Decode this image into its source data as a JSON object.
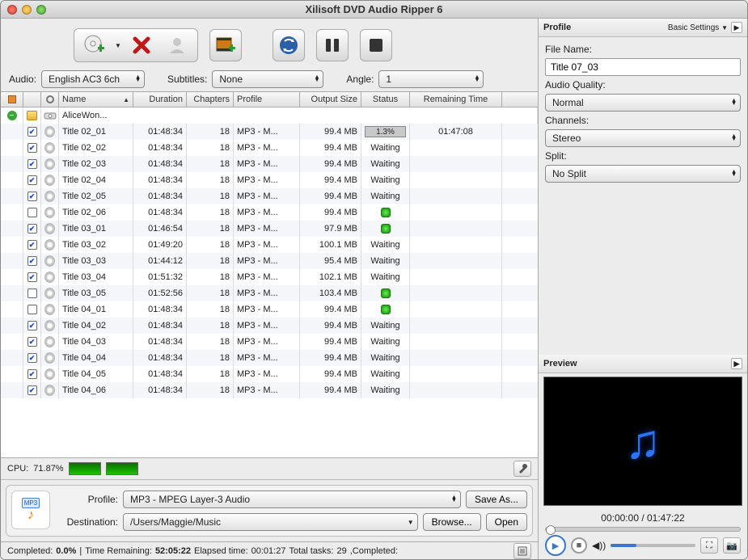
{
  "title": "Xilisoft DVD Audio Ripper 6",
  "filters": {
    "audio_label": "Audio:",
    "audio_value": "English AC3 6ch",
    "subtitles_label": "Subtitles:",
    "subtitles_value": "None",
    "angle_label": "Angle:",
    "angle_value": "1"
  },
  "columns": {
    "name": "Name",
    "duration": "Duration",
    "chapters": "Chapters",
    "profile": "Profile",
    "output": "Output Size",
    "status": "Status",
    "remaining": "Remaining Time"
  },
  "root_row": {
    "name": "AliceWon..."
  },
  "rows": [
    {
      "checked": true,
      "name": "Title 02_01",
      "duration": "01:48:34",
      "chapters": "18",
      "profile": "MP3 - M...",
      "output": "99.4 MB",
      "status": "progress",
      "progress": "1.3%",
      "remaining": "01:47:08"
    },
    {
      "checked": true,
      "name": "Title 02_02",
      "duration": "01:48:34",
      "chapters": "18",
      "profile": "MP3 - M...",
      "output": "99.4 MB",
      "status": "Waiting"
    },
    {
      "checked": true,
      "name": "Title 02_03",
      "duration": "01:48:34",
      "chapters": "18",
      "profile": "MP3 - M...",
      "output": "99.4 MB",
      "status": "Waiting"
    },
    {
      "checked": true,
      "name": "Title 02_04",
      "duration": "01:48:34",
      "chapters": "18",
      "profile": "MP3 - M...",
      "output": "99.4 MB",
      "status": "Waiting"
    },
    {
      "checked": true,
      "name": "Title 02_05",
      "duration": "01:48:34",
      "chapters": "18",
      "profile": "MP3 - M...",
      "output": "99.4 MB",
      "status": "Waiting"
    },
    {
      "checked": false,
      "name": "Title 02_06",
      "duration": "01:48:34",
      "chapters": "18",
      "profile": "MP3 - M...",
      "output": "99.4 MB",
      "status": "done"
    },
    {
      "checked": true,
      "name": "Title 03_01",
      "duration": "01:46:54",
      "chapters": "18",
      "profile": "MP3 - M...",
      "output": "97.9 MB",
      "status": "done"
    },
    {
      "checked": true,
      "name": "Title 03_02",
      "duration": "01:49:20",
      "chapters": "18",
      "profile": "MP3 - M...",
      "output": "100.1 MB",
      "status": "Waiting"
    },
    {
      "checked": true,
      "name": "Title 03_03",
      "duration": "01:44:12",
      "chapters": "18",
      "profile": "MP3 - M...",
      "output": "95.4 MB",
      "status": "Waiting"
    },
    {
      "checked": true,
      "name": "Title 03_04",
      "duration": "01:51:32",
      "chapters": "18",
      "profile": "MP3 - M...",
      "output": "102.1 MB",
      "status": "Waiting"
    },
    {
      "checked": false,
      "name": "Title 03_05",
      "duration": "01:52:56",
      "chapters": "18",
      "profile": "MP3 - M...",
      "output": "103.4 MB",
      "status": "done"
    },
    {
      "checked": false,
      "name": "Title 04_01",
      "duration": "01:48:34",
      "chapters": "18",
      "profile": "MP3 - M...",
      "output": "99.4 MB",
      "status": "done"
    },
    {
      "checked": true,
      "name": "Title 04_02",
      "duration": "01:48:34",
      "chapters": "18",
      "profile": "MP3 - M...",
      "output": "99.4 MB",
      "status": "Waiting"
    },
    {
      "checked": true,
      "name": "Title 04_03",
      "duration": "01:48:34",
      "chapters": "18",
      "profile": "MP3 - M...",
      "output": "99.4 MB",
      "status": "Waiting"
    },
    {
      "checked": true,
      "name": "Title 04_04",
      "duration": "01:48:34",
      "chapters": "18",
      "profile": "MP3 - M...",
      "output": "99.4 MB",
      "status": "Waiting"
    },
    {
      "checked": true,
      "name": "Title 04_05",
      "duration": "01:48:34",
      "chapters": "18",
      "profile": "MP3 - M...",
      "output": "99.4 MB",
      "status": "Waiting"
    },
    {
      "checked": true,
      "name": "Title 04_06",
      "duration": "01:48:34",
      "chapters": "18",
      "profile": "MP3 - M...",
      "output": "99.4 MB",
      "status": "Waiting"
    }
  ],
  "cpu": {
    "label": "CPU:",
    "value": "71.87%"
  },
  "output": {
    "profile_label": "Profile:",
    "profile_value": "MP3 - MPEG Layer-3 Audio",
    "save_as": "Save As...",
    "dest_label": "Destination:",
    "dest_value": "/Users/Maggie/Music",
    "browse": "Browse...",
    "open": "Open"
  },
  "statusbar": {
    "completed_label": "Completed:",
    "completed_value": "0.0%",
    "sep": " | ",
    "remaining_label": "Time Remaining:",
    "remaining_value": "52:05:22",
    "elapsed_label": " Elapsed time: ",
    "elapsed_value": "00:01:27",
    "tasks_label": " Total tasks: ",
    "tasks_value": "29",
    "completed_suffix": " ,Completed:"
  },
  "profile_panel": {
    "title": "Profile",
    "settings": "Basic Settings",
    "file_name_label": "File Name:",
    "file_name_value": "Title 07_03",
    "audio_quality_label": "Audio Quality:",
    "audio_quality_value": "Normal",
    "channels_label": "Channels:",
    "channels_value": "Stereo",
    "split_label": "Split:",
    "split_value": "No Split"
  },
  "preview": {
    "title": "Preview",
    "time": "00:00:00 / 01:47:22"
  }
}
